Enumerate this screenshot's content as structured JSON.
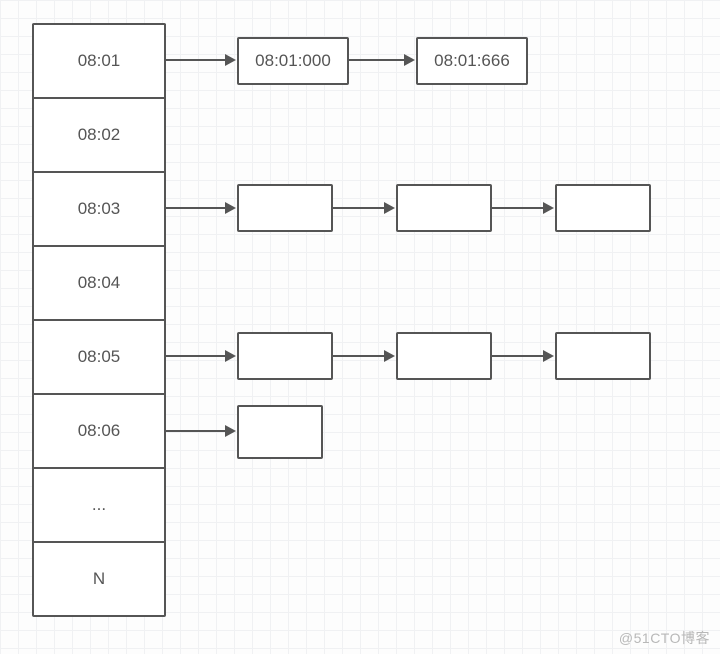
{
  "column": {
    "cells": [
      "08:01",
      "08:02",
      "08:03",
      "08:04",
      "08:05",
      "08:06",
      "...",
      "N"
    ]
  },
  "rows": {
    "r1": {
      "nodes": [
        "08:01:000",
        "08:01:666"
      ]
    },
    "r3": {
      "nodes": [
        "",
        "",
        ""
      ]
    },
    "r5": {
      "nodes": [
        "",
        "",
        ""
      ]
    },
    "r6": {
      "nodes": [
        ""
      ]
    }
  },
  "watermark": "@51CTO博客"
}
